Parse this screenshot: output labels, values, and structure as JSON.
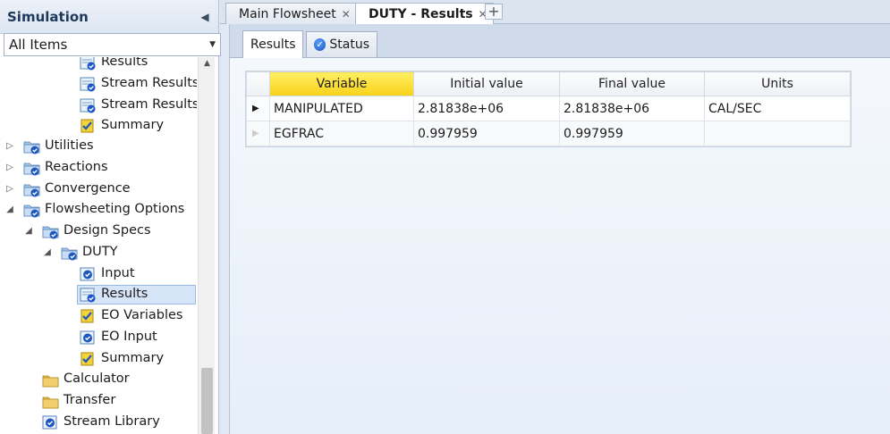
{
  "navigation": {
    "title": "Simulation",
    "filter_value": "All Items",
    "tree": [
      {
        "label": "Results",
        "icon": "results-icon",
        "level": 3
      },
      {
        "label": "Stream Results",
        "icon": "results-icon",
        "level": 3
      },
      {
        "label": "Stream Results (Cus",
        "icon": "results-icon",
        "level": 3
      },
      {
        "label": "Summary",
        "icon": "summary-icon",
        "level": 3
      },
      {
        "label": "Utilities",
        "icon": "folder-check-icon",
        "level": 0,
        "expander": "collapsed"
      },
      {
        "label": "Reactions",
        "icon": "folder-check-icon",
        "level": 0,
        "expander": "collapsed"
      },
      {
        "label": "Convergence",
        "icon": "folder-check-icon",
        "level": 0,
        "expander": "collapsed"
      },
      {
        "label": "Flowsheeting Options",
        "icon": "folder-check-icon",
        "level": 0,
        "expander": "expanded"
      },
      {
        "label": "Design Specs",
        "icon": "folder-check-icon",
        "level": 1,
        "expander": "expanded"
      },
      {
        "label": "DUTY",
        "icon": "folder-check-icon",
        "level": 2,
        "expander": "expanded"
      },
      {
        "label": "Input",
        "icon": "input-icon",
        "level": 3
      },
      {
        "label": "Results",
        "icon": "results-icon",
        "level": 3,
        "selected": true
      },
      {
        "label": "EO Variables",
        "icon": "summary-icon",
        "level": 3
      },
      {
        "label": "EO Input",
        "icon": "input-icon",
        "level": 3
      },
      {
        "label": "Summary",
        "icon": "summary-icon",
        "level": 3
      },
      {
        "label": "Calculator",
        "icon": "folder-icon",
        "level": 1
      },
      {
        "label": "Transfer",
        "icon": "folder-icon",
        "level": 1
      },
      {
        "label": "Stream Library",
        "icon": "input-icon",
        "level": 1
      }
    ]
  },
  "doc_tabs": {
    "tab1": "Main Flowsheet",
    "tab2": "DUTY - Results",
    "new_tab": "+"
  },
  "sub_tabs": {
    "results": "Results",
    "status": "Status"
  },
  "grid": {
    "columns": [
      "Variable",
      "Initial value",
      "Final value",
      "Units"
    ],
    "rows": [
      {
        "variable": "MANIPULATED",
        "initial": "2.81838e+06",
        "final": "2.81838e+06",
        "units": "CAL/SEC"
      },
      {
        "variable": "EGFRAC",
        "initial": "0.997959",
        "final": "0.997959",
        "units": ""
      }
    ]
  },
  "colors": {
    "header_highlight": "#f9d11a",
    "selection": "#d6e6f8",
    "folder": "#e9b949",
    "check": "#1b56c2"
  }
}
